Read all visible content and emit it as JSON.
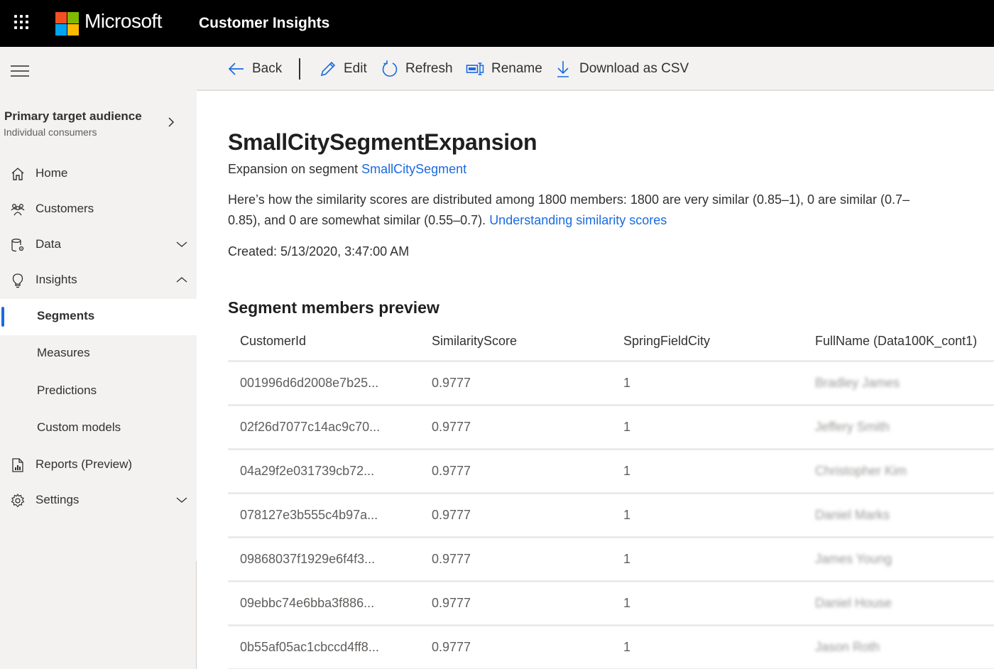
{
  "topbar": {
    "brand": "Microsoft",
    "app_title": "Customer Insights",
    "logo_colors": [
      "#f25022",
      "#7fba00",
      "#00a4ef",
      "#ffb900"
    ]
  },
  "sidebar": {
    "audience": {
      "title": "Primary target audience",
      "subtitle": "Individual consumers"
    },
    "items": [
      {
        "label": "Home",
        "icon": "home-icon"
      },
      {
        "label": "Customers",
        "icon": "people-icon"
      },
      {
        "label": "Data",
        "icon": "database-gear-icon",
        "chevron": "down"
      },
      {
        "label": "Insights",
        "icon": "lightbulb-icon",
        "chevron": "up"
      },
      {
        "label": "Segments",
        "active": true
      },
      {
        "label": "Measures"
      },
      {
        "label": "Predictions"
      },
      {
        "label": "Custom models"
      },
      {
        "label": "Reports (Preview)",
        "icon": "report-icon"
      },
      {
        "label": "Settings",
        "icon": "gear-icon",
        "chevron": "down"
      }
    ]
  },
  "commandbar": {
    "back": "Back",
    "edit": "Edit",
    "refresh": "Refresh",
    "rename": "Rename",
    "download": "Download as CSV"
  },
  "main": {
    "title": "SmallCitySegmentExpansion",
    "subtitle_prefix": "Expansion on segment ",
    "subtitle_link": "SmallCitySegment",
    "description": "Here’s how the similarity scores are distributed among 1800 members: 1800 are very similar (0.85–1), 0 are similar (0.7–0.85), and 0 are somewhat similar (0.55–0.7). ",
    "description_link": "Understanding similarity scores",
    "created": "Created: 5/13/2020, 3:47:00 AM",
    "section_title": "Segment members preview"
  },
  "table": {
    "columns": [
      "CustomerId",
      "SimilarityScore",
      "SpringFieldCity",
      "FullName (Data100K_cont1)"
    ],
    "rows": [
      [
        "001996d6d2008e7b25...",
        "0.9777",
        "1",
        "Bradley James"
      ],
      [
        "02f26d7077c14ac9c70...",
        "0.9777",
        "1",
        "Jeffery Smith"
      ],
      [
        "04a29f2e031739cb72...",
        "0.9777",
        "1",
        "Christopher Kim"
      ],
      [
        "078127e3b555c4b97a...",
        "0.9777",
        "1",
        "Daniel Marks"
      ],
      [
        "09868037f1929e6f4f3...",
        "0.9777",
        "1",
        "James Young"
      ],
      [
        "09ebbc74e6bba3f886...",
        "0.9777",
        "1",
        "Daniel House"
      ],
      [
        "0b55af05ac1cbccd4ff8...",
        "0.9777",
        "1",
        "Jason Roth"
      ]
    ],
    "fullname_blurred": true
  },
  "colors": {
    "accent": "#1a6ae0",
    "topbar_bg": "#000000",
    "sidebar_bg": "#f3f2f1"
  }
}
